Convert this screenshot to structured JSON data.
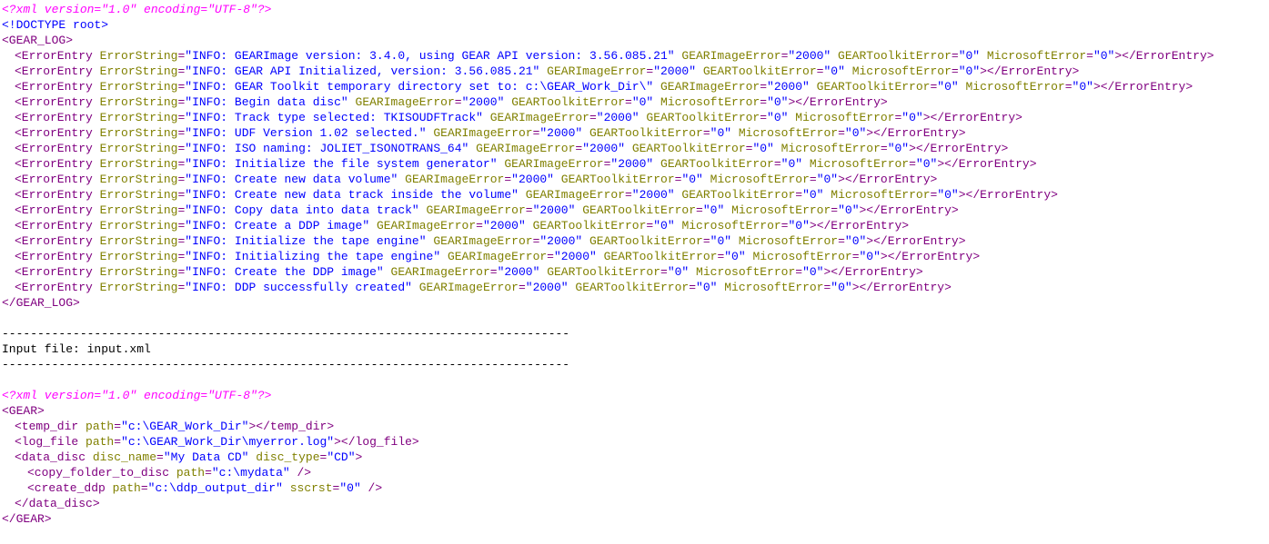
{
  "block1": {
    "xml_decl": "<?xml version=\"1.0\" encoding=\"UTF-8\"?>",
    "doctype": "<!DOCTYPE root>",
    "root_open": "<GEAR_LOG>",
    "root_close": "</GEAR_LOG>",
    "entries": [
      {
        "ErrorString": "INFO: GEARImage version: 3.4.0, using GEAR API version: 3.56.085.21",
        "GEARImageError": "2000",
        "GEARToolkitError": "0",
        "MicrosoftError": "0"
      },
      {
        "ErrorString": "INFO: GEAR API Initialized, version: 3.56.085.21",
        "GEARImageError": "2000",
        "GEARToolkitError": "0",
        "MicrosoftError": "0"
      },
      {
        "ErrorString": "INFO: GEAR Toolkit temporary directory set to: c:\\GEAR_Work_Dir\\",
        "GEARImageError": "2000",
        "GEARToolkitError": "0",
        "MicrosoftError": "0"
      },
      {
        "ErrorString": "INFO: Begin data disc",
        "GEARImageError": "2000",
        "GEARToolkitError": "0",
        "MicrosoftError": "0"
      },
      {
        "ErrorString": "INFO: Track type selected: TKISOUDFTrack",
        "GEARImageError": "2000",
        "GEARToolkitError": "0",
        "MicrosoftError": "0"
      },
      {
        "ErrorString": "INFO: UDF Version 1.02 selected.",
        "GEARImageError": "2000",
        "GEARToolkitError": "0",
        "MicrosoftError": "0"
      },
      {
        "ErrorString": "INFO: ISO naming: JOLIET_ISONOTRANS_64",
        "GEARImageError": "2000",
        "GEARToolkitError": "0",
        "MicrosoftError": "0"
      },
      {
        "ErrorString": "INFO: Initialize the file system generator",
        "GEARImageError": "2000",
        "GEARToolkitError": "0",
        "MicrosoftError": "0"
      },
      {
        "ErrorString": "INFO: Create new data volume",
        "GEARImageError": "2000",
        "GEARToolkitError": "0",
        "MicrosoftError": "0"
      },
      {
        "ErrorString": "INFO: Create new data track inside the volume",
        "GEARImageError": "2000",
        "GEARToolkitError": "0",
        "MicrosoftError": "0"
      },
      {
        "ErrorString": "INFO: Copy data into data track",
        "GEARImageError": "2000",
        "GEARToolkitError": "0",
        "MicrosoftError": "0"
      },
      {
        "ErrorString": "INFO: Create a DDP image",
        "GEARImageError": "2000",
        "GEARToolkitError": "0",
        "MicrosoftError": "0"
      },
      {
        "ErrorString": "INFO: Initialize the tape engine",
        "GEARImageError": "2000",
        "GEARToolkitError": "0",
        "MicrosoftError": "0"
      },
      {
        "ErrorString": "INFO: Initializing the tape engine",
        "GEARImageError": "2000",
        "GEARToolkitError": "0",
        "MicrosoftError": "0"
      },
      {
        "ErrorString": "INFO: Create the DDP image",
        "GEARImageError": "2000",
        "GEARToolkitError": "0",
        "MicrosoftError": "0"
      },
      {
        "ErrorString": "INFO: DDP successfully created",
        "GEARImageError": "2000",
        "GEARToolkitError": "0",
        "MicrosoftError": "0"
      }
    ]
  },
  "separator": "--------------------------------------------------------------------------------",
  "input_file_line": "Input file: input.xml",
  "block2": {
    "xml_decl": "<?xml version=\"1.0\" encoding=\"UTF-8\"?>",
    "root_open": "<GEAR>",
    "root_close": "</GEAR>",
    "temp_dir": {
      "tag": "temp_dir",
      "attr_name": "path",
      "attr_val": "c:\\GEAR_Work_Dir"
    },
    "log_file": {
      "tag": "log_file",
      "attr_name": "path",
      "attr_val": "c:\\GEAR_Work_Dir\\myerror.log"
    },
    "data_disc": {
      "tag": "data_disc",
      "attrs": [
        {
          "name": "disc_name",
          "val": "My Data CD"
        },
        {
          "name": "disc_type",
          "val": "CD"
        }
      ],
      "children": [
        {
          "tag": "copy_folder_to_disc",
          "attrs": [
            {
              "name": "path",
              "val": "c:\\mydata"
            }
          ],
          "selfclose": true
        },
        {
          "tag": "create_ddp",
          "attrs": [
            {
              "name": "path",
              "val": "c:\\ddp_output_dir"
            },
            {
              "name": "sscrst",
              "val": "0"
            }
          ],
          "selfclose": true
        }
      ],
      "close": "</data_disc>"
    }
  }
}
